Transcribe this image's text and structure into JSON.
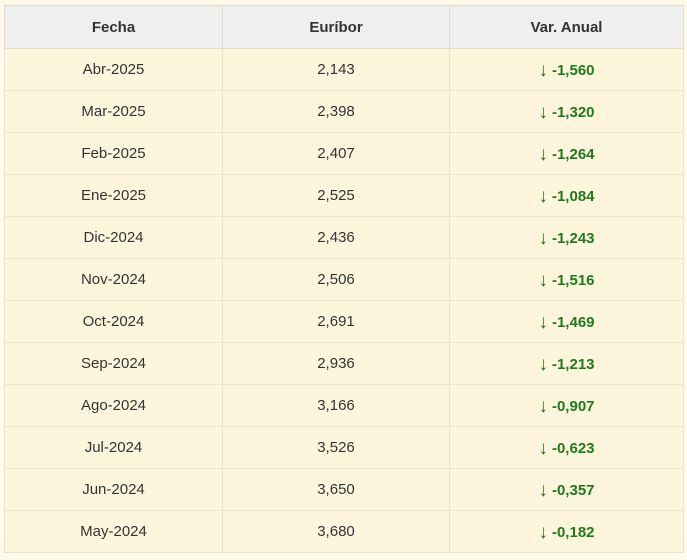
{
  "table": {
    "headers": [
      "Fecha",
      "Euríbor",
      "Var. Anual"
    ],
    "down_arrow_icon": "↓",
    "accent_color": "#1e7a1e",
    "rows": [
      {
        "fecha": "Abr-2025",
        "euribor": "2,143",
        "var": "-1,560"
      },
      {
        "fecha": "Mar-2025",
        "euribor": "2,398",
        "var": "-1,320"
      },
      {
        "fecha": "Feb-2025",
        "euribor": "2,407",
        "var": "-1,264"
      },
      {
        "fecha": "Ene-2025",
        "euribor": "2,525",
        "var": "-1,084"
      },
      {
        "fecha": "Dic-2024",
        "euribor": "2,436",
        "var": "-1,243"
      },
      {
        "fecha": "Nov-2024",
        "euribor": "2,506",
        "var": "-1,516"
      },
      {
        "fecha": "Oct-2024",
        "euribor": "2,691",
        "var": "-1,469"
      },
      {
        "fecha": "Sep-2024",
        "euribor": "2,936",
        "var": "-1,213"
      },
      {
        "fecha": "Ago-2024",
        "euribor": "3,166",
        "var": "-0,907"
      },
      {
        "fecha": "Jul-2024",
        "euribor": "3,526",
        "var": "-0,623"
      },
      {
        "fecha": "Jun-2024",
        "euribor": "3,650",
        "var": "-0,357"
      },
      {
        "fecha": "May-2024",
        "euribor": "3,680",
        "var": "-0,182"
      }
    ]
  }
}
